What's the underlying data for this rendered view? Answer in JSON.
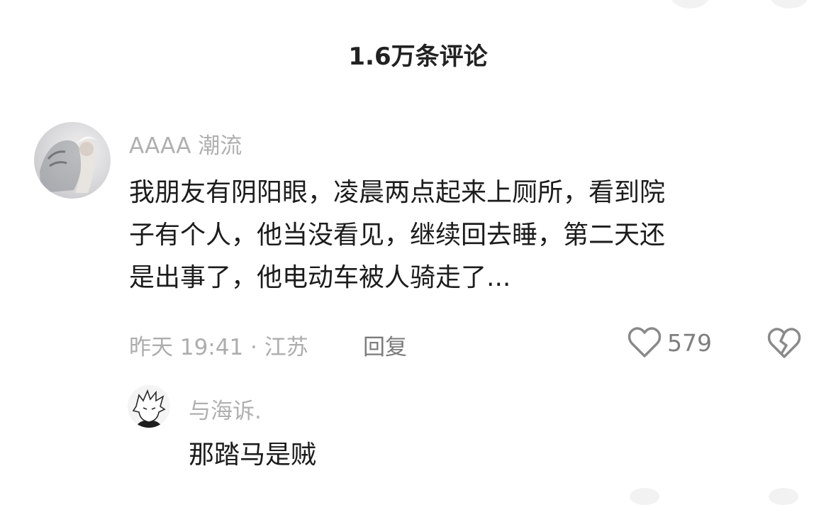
{
  "header": {
    "title": "1.6万条评论"
  },
  "comment": {
    "author": "AAAA 潮流",
    "text_lines": [
      "我朋友有阴阳眼，凌晨两点起来上厕所，看到院",
      "子有个人，他当没看见，继续回去睡，第二天还",
      "是出事了，他电动车被人骑走了..."
    ],
    "time_location": "昨天 19:41 · 江苏",
    "reply_label": "回复",
    "likes": "579",
    "like_icon": "heart-outline-icon",
    "dislike_icon": "broken-heart-icon"
  },
  "reply": {
    "author": "与海诉.",
    "text": "那踏马是贼"
  },
  "colors": {
    "title": "#222222",
    "body_text": "#1c1c1c",
    "muted": "#adadad",
    "icon": "#8a8a8a"
  }
}
